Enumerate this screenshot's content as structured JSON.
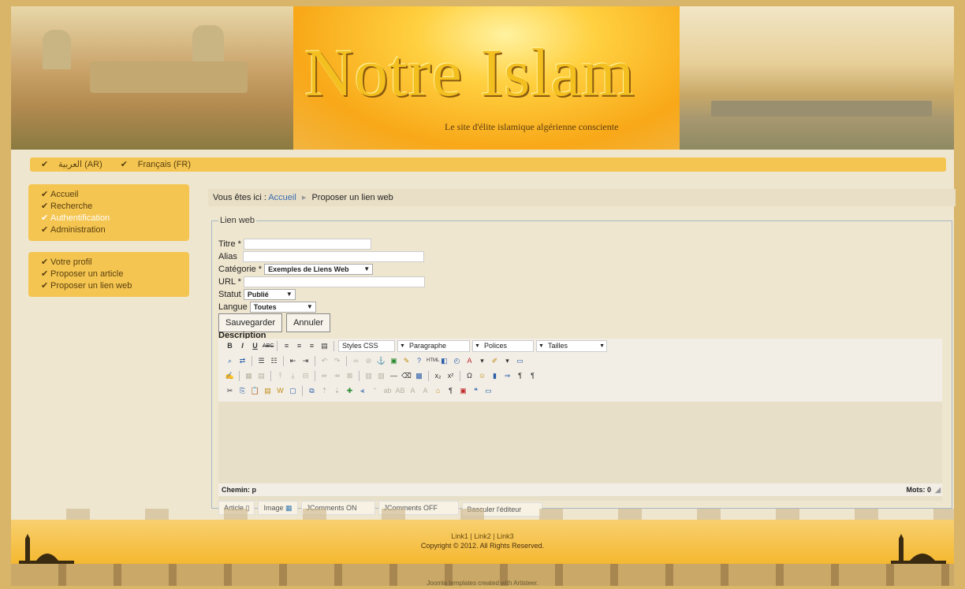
{
  "header": {
    "title": "Notre Islam",
    "tagline": "Le site d'élite islamique algérienne consciente"
  },
  "languages": [
    {
      "label": "العربية (AR)"
    },
    {
      "label": "Français (FR)"
    }
  ],
  "menu_main": [
    {
      "label": "Accueil",
      "active": false
    },
    {
      "label": "Recherche",
      "active": false
    },
    {
      "label": "Authentification",
      "active": true
    },
    {
      "label": "Administration",
      "active": false
    }
  ],
  "menu_user": [
    {
      "label": "Votre profil"
    },
    {
      "label": "Proposer un article"
    },
    {
      "label": "Proposer un lien web"
    }
  ],
  "breadcrumb": {
    "prefix": "Vous êtes ici :",
    "home": "Accueil",
    "current": "Proposer un lien web"
  },
  "form": {
    "legend": "Lien web",
    "titre_label": "Titre *",
    "titre_value": "",
    "alias_label": "Alias",
    "alias_value": "",
    "categorie_label": "Catégorie *",
    "categorie_value": "Exemples de Liens Web",
    "url_label": "URL *",
    "url_value": "",
    "statut_label": "Statut",
    "statut_value": "Publié",
    "langue_label": "Langue",
    "langue_value": "Toutes",
    "save_label": "Sauvegarder",
    "cancel_label": "Annuler",
    "description_label": "Description"
  },
  "editor": {
    "styles_select": "Styles CSS",
    "format_select": "Paragraphe",
    "font_select": "Polices",
    "size_select": "Tailles",
    "path_label": "Chemin: p",
    "word_count": "Mots: 0",
    "buttons": [
      {
        "label": "Article"
      },
      {
        "label": "Image"
      },
      {
        "label": "JComments ON"
      },
      {
        "label": "JComments OFF"
      },
      {
        "label": "Basculer l'éditeur"
      }
    ]
  },
  "footer": {
    "links": "Link1 | Link2 | Link3",
    "copyright": "Copyright © 2012. All Rights Reserved.",
    "credit": "Joomla templates created with Artisteer."
  }
}
